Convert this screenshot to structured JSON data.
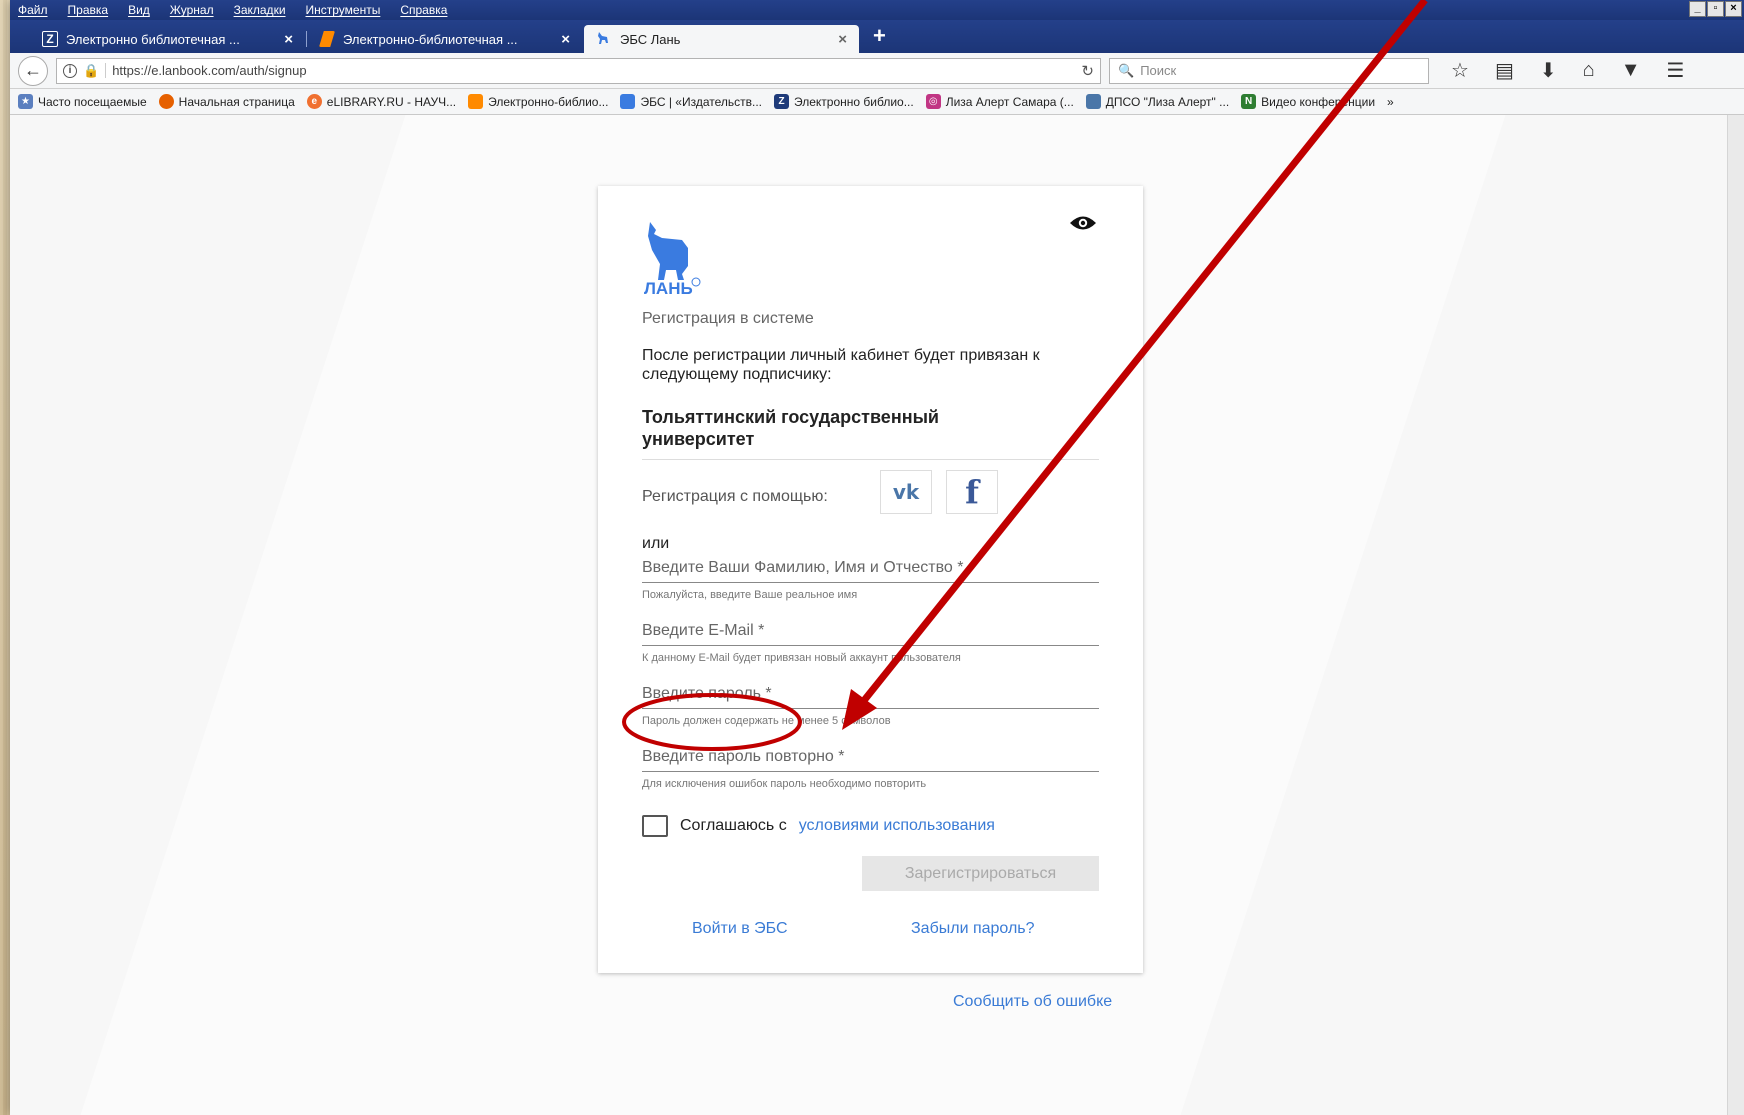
{
  "menu": {
    "items": [
      "Файл",
      "Правка",
      "Вид",
      "Журнал",
      "Закладки",
      "Инструменты",
      "Справка"
    ],
    "window_controls": [
      "_",
      "▫",
      "×"
    ]
  },
  "tabs": [
    {
      "title": "Электронно библиотечная ...",
      "icon": "z-logo-icon",
      "close": "×"
    },
    {
      "title": "Электронно-библиотечная ...",
      "icon": "znanium-logo-icon",
      "close": "×"
    },
    {
      "title": "ЭБС Лань",
      "icon": "lan-deer-icon",
      "close": "×"
    }
  ],
  "new_tab": "+",
  "nav": {
    "url": "https://e.lanbook.com/auth/signup",
    "search_placeholder": "Поиск"
  },
  "bookmarks": [
    {
      "label": "Часто посещаемые",
      "icon": "star-icon",
      "color": "#5b7fbf"
    },
    {
      "label": "Начальная страница",
      "icon": "firefox-icon",
      "color": "#e66000"
    },
    {
      "label": "eLIBRARY.RU - НАУЧ...",
      "icon": "elibrary-icon",
      "color": "#f07030"
    },
    {
      "label": "Электронно-библио...",
      "icon": "znanium-logo-icon",
      "color": "#ff8a00"
    },
    {
      "label": "ЭБС | «Издательств...",
      "icon": "lan-deer-icon",
      "color": "#3a7be0"
    },
    {
      "label": "Электронно библио...",
      "icon": "z-logo-icon",
      "color": "#1f3b7a"
    },
    {
      "label": "Лиза Алерт Самара (...",
      "icon": "instagram-icon",
      "color": "#c13584"
    },
    {
      "label": "ДПСО \"Лиза Алерт\" ...",
      "icon": "vk-icon",
      "color": "#4a76a8"
    },
    {
      "label": "Видео конференции",
      "icon": "n-icon",
      "color": "#2e7d32"
    }
  ],
  "bookmarks_overflow": "»",
  "form": {
    "logo_text": "ЛАНЬ",
    "subtitle": "Регистрация в системе",
    "info": "После регистрации личный кабинет будет привязан к следующему подписчику:",
    "organization": "Тольяттинский государственный университет",
    "social_label": "Регистрация с помощью:",
    "vk_label": "vk",
    "fb_label": "f",
    "or": "или",
    "fields": [
      {
        "placeholder": "Введите Ваши Фамилию, Имя и Отчество *",
        "hint": "Пожалуйста, введите Ваше реальное имя"
      },
      {
        "placeholder": "Введите E-Mail *",
        "hint": "К данному E-Mail будет привязан новый аккаунт пользователя"
      },
      {
        "placeholder": "Введите пароль *",
        "hint": "Пароль должен содержать не менее 5 символов"
      },
      {
        "placeholder": "Введите пароль повторно *",
        "hint": "Для исключения ошибок пароль необходимо повторить"
      }
    ],
    "agree_text": "Соглашаюсь с",
    "agree_link": "условиями использования",
    "submit": "Зарегистрироваться",
    "login_link": "Войти в ЭБС",
    "forgot_link": "Забыли пароль?"
  },
  "report_link": "Сообщить об ошибке",
  "colors": {
    "accent": "#3a7bd5",
    "annotation": "#c00000",
    "browser_chrome": "#24408a"
  }
}
